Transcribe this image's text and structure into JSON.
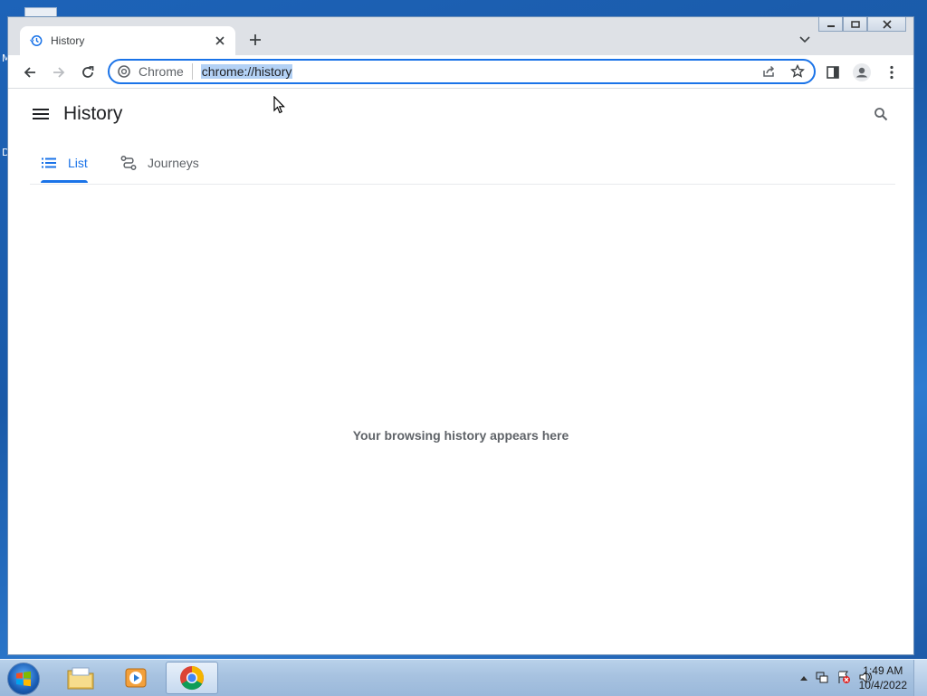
{
  "desktop": {
    "edge_glyph_top": "M",
    "edge_glyph_mid": "D"
  },
  "browser": {
    "tab": {
      "title": "History"
    },
    "omnibox": {
      "chip_label": "Chrome",
      "url": "chrome://history"
    }
  },
  "page": {
    "title": "History",
    "tabs": [
      {
        "label": "List",
        "active": true
      },
      {
        "label": "Journeys",
        "active": false
      }
    ],
    "empty_message": "Your browsing history appears here"
  },
  "taskbar": {
    "time": "1:49 AM",
    "date": "10/4/2022",
    "apps": [
      "windows-explorer",
      "media-player",
      "chrome"
    ]
  },
  "colors": {
    "accent": "#1a73e8",
    "selection": "#b3d1f5"
  }
}
